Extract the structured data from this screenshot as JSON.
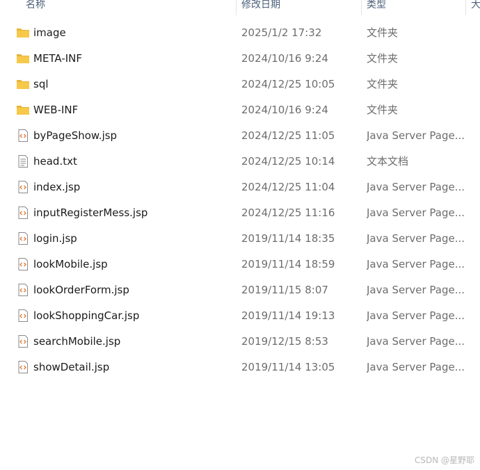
{
  "columns": {
    "name": "名称",
    "modified": "修改日期",
    "type": "类型",
    "size": "大"
  },
  "files": [
    {
      "name": "image",
      "modified": "2025/1/2 17:32",
      "type": "文件夹",
      "icon": "folder-icon"
    },
    {
      "name": "META-INF",
      "modified": "2024/10/16 9:24",
      "type": "文件夹",
      "icon": "folder-icon"
    },
    {
      "name": "sql",
      "modified": "2024/12/25 10:05",
      "type": "文件夹",
      "icon": "folder-icon"
    },
    {
      "name": "WEB-INF",
      "modified": "2024/10/16 9:24",
      "type": "文件夹",
      "icon": "folder-icon"
    },
    {
      "name": "byPageShow.jsp",
      "modified": "2024/12/25 11:05",
      "type": "Java Server Page...",
      "icon": "jsp-file-icon"
    },
    {
      "name": "head.txt",
      "modified": "2024/12/25 10:14",
      "type": "文本文档",
      "icon": "text-file-icon"
    },
    {
      "name": "index.jsp",
      "modified": "2024/12/25 11:04",
      "type": "Java Server Page...",
      "icon": "jsp-file-icon"
    },
    {
      "name": "inputRegisterMess.jsp",
      "modified": "2024/12/25 11:16",
      "type": "Java Server Page...",
      "icon": "jsp-file-icon"
    },
    {
      "name": "login.jsp",
      "modified": "2019/11/14 18:35",
      "type": "Java Server Page...",
      "icon": "jsp-file-icon"
    },
    {
      "name": "lookMobile.jsp",
      "modified": "2019/11/14 18:59",
      "type": "Java Server Page...",
      "icon": "jsp-file-icon"
    },
    {
      "name": "lookOrderForm.jsp",
      "modified": "2019/11/15 8:07",
      "type": "Java Server Page...",
      "icon": "jsp-file-icon"
    },
    {
      "name": "lookShoppingCar.jsp",
      "modified": "2019/11/14 19:13",
      "type": "Java Server Page...",
      "icon": "jsp-file-icon"
    },
    {
      "name": "searchMobile.jsp",
      "modified": "2019/12/15 8:53",
      "type": "Java Server Page...",
      "icon": "jsp-file-icon"
    },
    {
      "name": "showDetail.jsp",
      "modified": "2019/11/14 13:05",
      "type": "Java Server Page...",
      "icon": "jsp-file-icon"
    }
  ],
  "watermark": "CSDN @星野耶",
  "colors": {
    "folder": "#f6c94b",
    "folder_tab": "#e8b43a",
    "jsp_accent": "#e07a3a"
  }
}
